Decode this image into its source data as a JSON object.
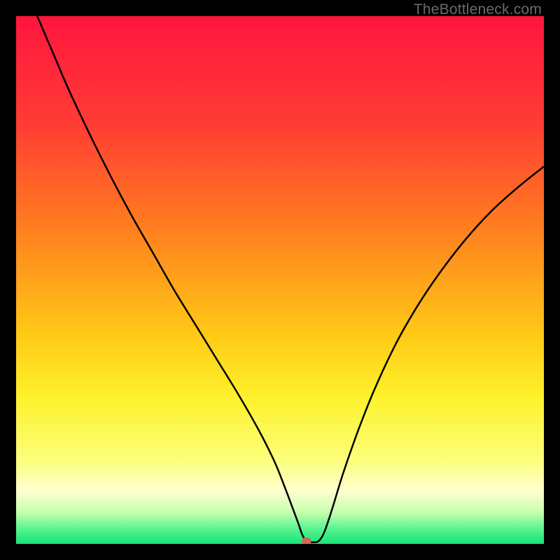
{
  "watermark": "TheBottleneck.com",
  "chart_data": {
    "type": "line",
    "title": "",
    "xlabel": "",
    "ylabel": "",
    "xlim": [
      0,
      100
    ],
    "ylim": [
      0,
      100
    ],
    "grid": false,
    "legend": false,
    "background_gradient": {
      "stops": [
        {
          "offset": 0.0,
          "color": "#ff153f"
        },
        {
          "offset": 0.2,
          "color": "#ff3b34"
        },
        {
          "offset": 0.4,
          "color": "#ff7e1f"
        },
        {
          "offset": 0.6,
          "color": "#ffc816"
        },
        {
          "offset": 0.72,
          "color": "#fdf12a"
        },
        {
          "offset": 0.84,
          "color": "#fcff7a"
        },
        {
          "offset": 0.9,
          "color": "#feffd0"
        },
        {
          "offset": 0.94,
          "color": "#c7ffaf"
        },
        {
          "offset": 0.97,
          "color": "#5cf590"
        },
        {
          "offset": 1.0,
          "color": "#17e47a"
        }
      ]
    },
    "series": [
      {
        "name": "curve",
        "color": "#000000",
        "width": 2.5,
        "x": [
          4.0,
          7,
          10,
          14,
          18,
          22,
          26,
          30,
          34,
          38,
          42,
          46,
          49,
          51,
          52.5,
          53.5,
          54.2,
          55.0,
          56.5,
          57.5,
          58.5,
          60,
          62,
          65,
          68,
          72,
          76,
          80,
          85,
          90,
          95,
          100
        ],
        "y": [
          100,
          93,
          86,
          77.5,
          69.5,
          62,
          55,
          48,
          41.5,
          35,
          28.5,
          21.5,
          15.5,
          10.5,
          6.5,
          3.8,
          1.8,
          0.6,
          0.3,
          0.7,
          2.5,
          7.0,
          13.5,
          22,
          29.5,
          38,
          45,
          51,
          57.5,
          63,
          67.5,
          71.5
        ]
      }
    ],
    "marker": {
      "x": 55.0,
      "y": 0.5,
      "rx": 0.9,
      "ry": 0.75,
      "color": "#cf6a58"
    }
  }
}
